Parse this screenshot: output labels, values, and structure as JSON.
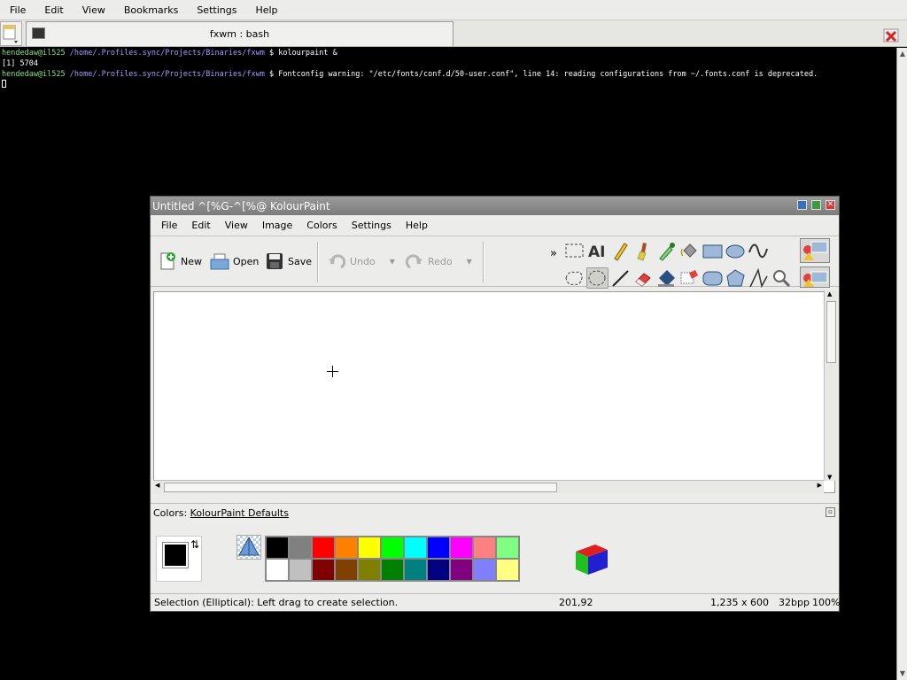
{
  "konsole": {
    "menu": [
      "File",
      "Edit",
      "View",
      "Bookmarks",
      "Settings",
      "Help"
    ],
    "tab_title": "fxwm : bash",
    "lines": [
      {
        "user": "hendedaw@il525",
        "path": "/home/.Profiles.sync/Projects/Binaries/fxwm",
        "prompt": " $ ",
        "text": "kolourpaint &"
      },
      {
        "user": "",
        "path": "",
        "prompt": "",
        "text": "[1] 5704"
      },
      {
        "user": "hendedaw@il525",
        "path": "/home/.Profiles.sync/Projects/Binaries/fxwm",
        "prompt": " $ ",
        "text": "Fontconfig warning: \"/etc/fonts/conf.d/50-user.conf\", line 14: reading configurations from ~/.fonts.conf is deprecated."
      }
    ]
  },
  "kolourpaint": {
    "title": "Untitled ^[%G-^[%@ KolourPaint",
    "menu": [
      "File",
      "Edit",
      "View",
      "Image",
      "Colors",
      "Settings",
      "Help"
    ],
    "toolbar": {
      "new": "New",
      "open": "Open",
      "save": "Save",
      "undo": "Undo",
      "redo": "Redo",
      "overflow": "»"
    },
    "tools_row1": [
      "rect-select-icon",
      "text-icon",
      "pen-icon",
      "brush-icon",
      "color-picker-icon",
      "flood-fill-icon",
      "rectangle-icon",
      "ellipse-icon",
      "curve-icon"
    ],
    "tools_row2": [
      "free-select-icon",
      "ellipse-select-icon",
      "line-icon",
      "eraser-icon",
      "color-washer-icon",
      "zoom-icon-2",
      "rounded-rect-icon",
      "polygon-icon",
      "polyline-icon",
      "zoom-icon"
    ],
    "colors_label_prefix": "Colors: ",
    "colors_label": "KolourPaint Defaults",
    "palette_row1": [
      "#000000",
      "#808080",
      "#ff0000",
      "#ff8000",
      "#ffff00",
      "#00ff00",
      "#00ffff",
      "#0000ff",
      "#ff00ff",
      "#ff8080",
      "#80ff80"
    ],
    "palette_row2": [
      "#ffffff",
      "#c0c0c0",
      "#800000",
      "#804000",
      "#808000",
      "#008000",
      "#008080",
      "#000080",
      "#800080",
      "#8080ff",
      "#ffff80"
    ],
    "status": {
      "message": "Selection (Elliptical): Left drag to create selection.",
      "position": "201,92",
      "size": "1,235 x 600",
      "depth": "32bpp",
      "zoom": "100%"
    }
  }
}
